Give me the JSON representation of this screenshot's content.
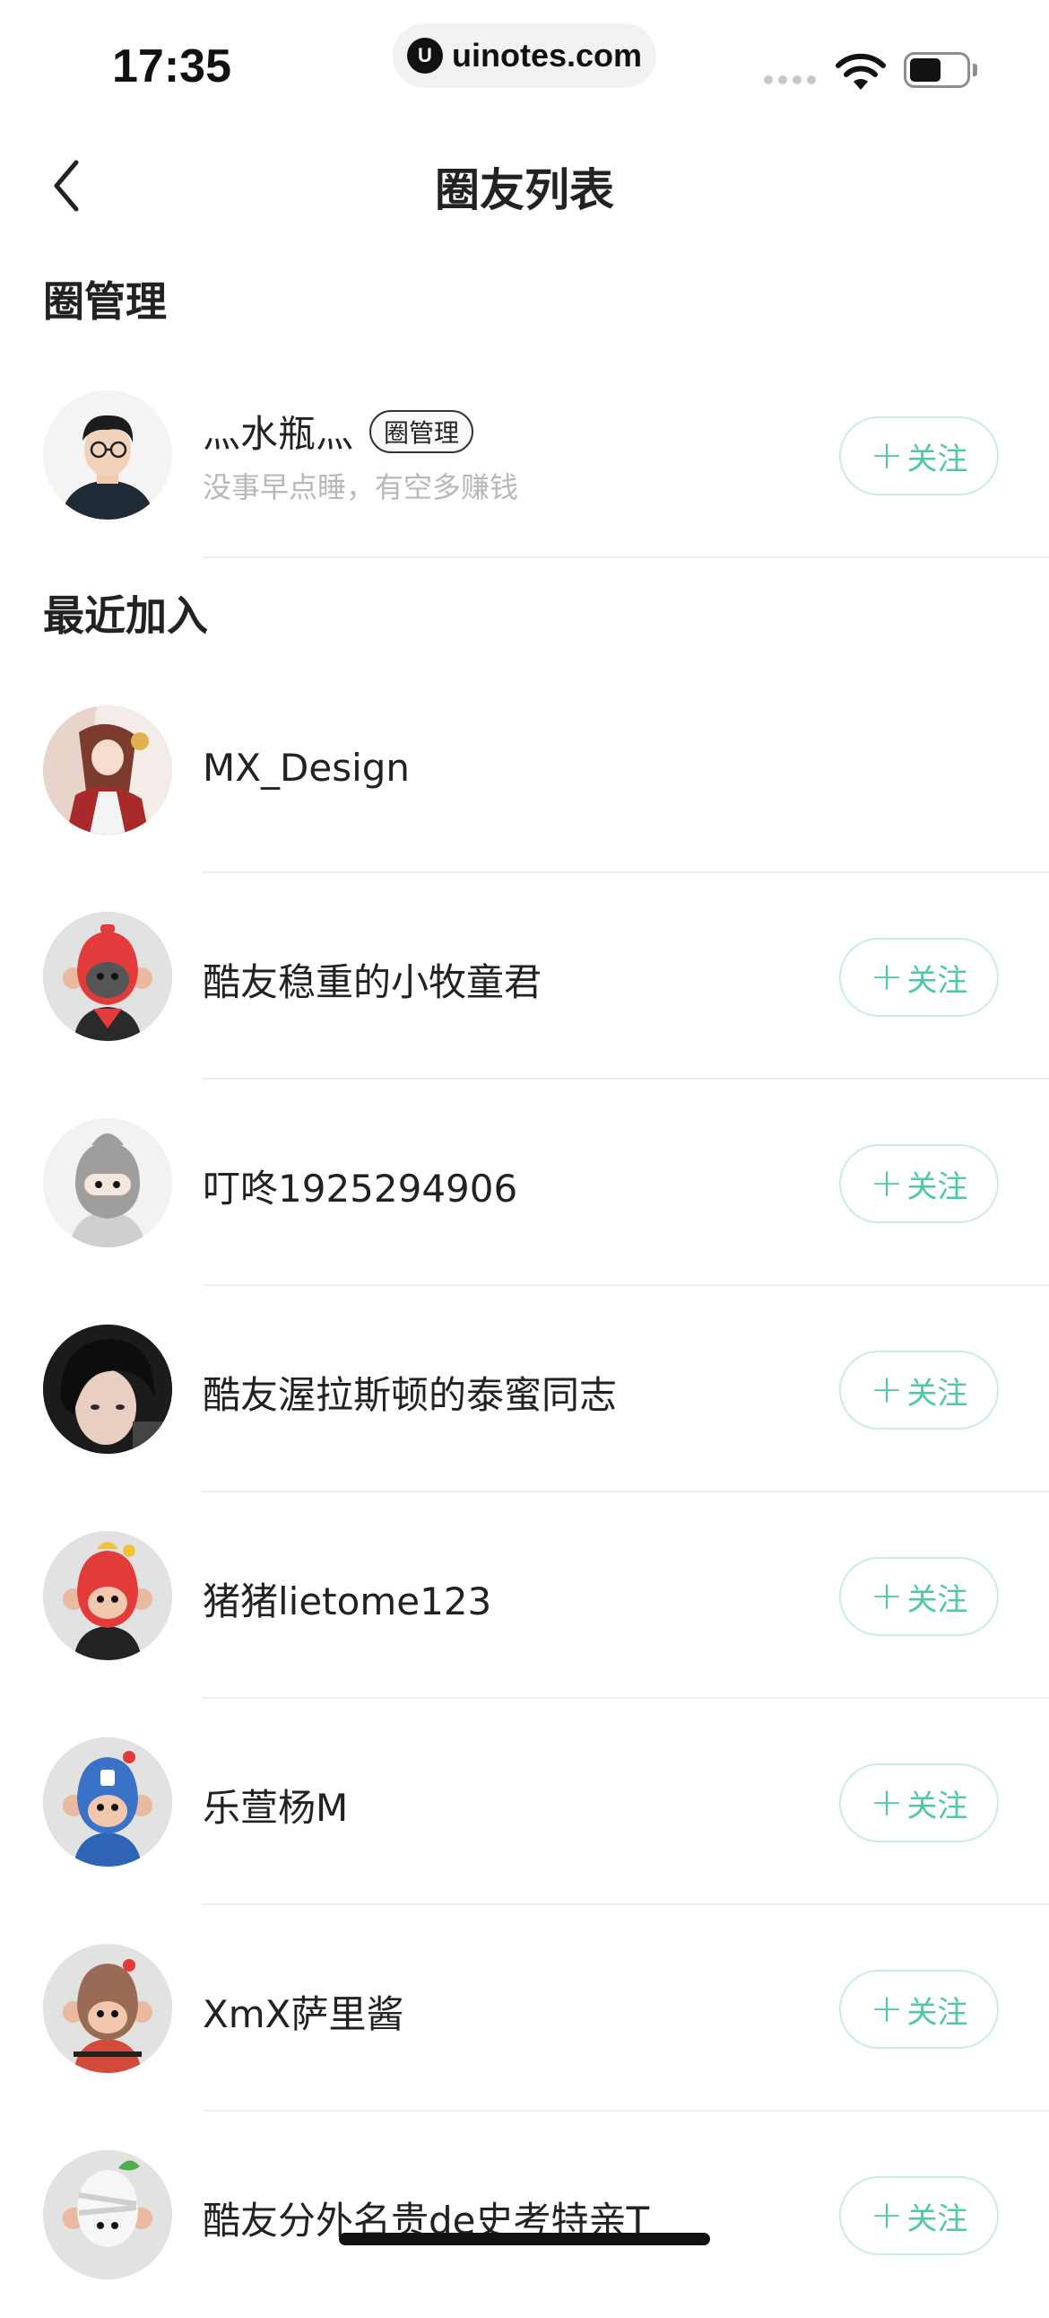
{
  "status_bar": {
    "time": "17:35",
    "watermark": "uinotes.com",
    "watermark_logo": "U"
  },
  "nav": {
    "title": "圈友列表",
    "back_icon": "chevron-left-icon"
  },
  "sections": {
    "admin_title": "圈管理",
    "recent_title": "最近加入"
  },
  "admin_member": {
    "name": "灬水瓶灬",
    "badge": "圈管理",
    "subtitle": "没事早点睡，有空多赚钱",
    "follow_label": "关注",
    "avatar": "cartoon-man-glasses"
  },
  "members": [
    {
      "name": "MX_Design",
      "follow_label": "",
      "avatar": "anime-illustration"
    },
    {
      "name": "酷友稳重的小牧童君",
      "follow_label": "关注",
      "avatar": "red-hood-monkey"
    },
    {
      "name": "叮咚1925294906",
      "follow_label": "关注",
      "avatar": "gray-ninja"
    },
    {
      "name": "酷友渥拉斯顿的泰蜜同志",
      "follow_label": "关注",
      "avatar": "dark-hair-portrait"
    },
    {
      "name": "猪猪lietome123",
      "follow_label": "关注",
      "avatar": "red-monkey-flower"
    },
    {
      "name": "乐萱杨M",
      "follow_label": "关注",
      "avatar": "blue-hero-monkey"
    },
    {
      "name": "XmX萨里酱",
      "follow_label": "关注",
      "avatar": "brown-monkey-bow"
    },
    {
      "name": "酷友分外名贵de史考特亲T",
      "follow_label": "关注",
      "avatar": "bandage-monkey"
    }
  ],
  "colors": {
    "accent": "#4ec9a0",
    "accent_border": "#c8eee0",
    "subtitle": "#b8b8b8",
    "divider": "#efefef"
  }
}
